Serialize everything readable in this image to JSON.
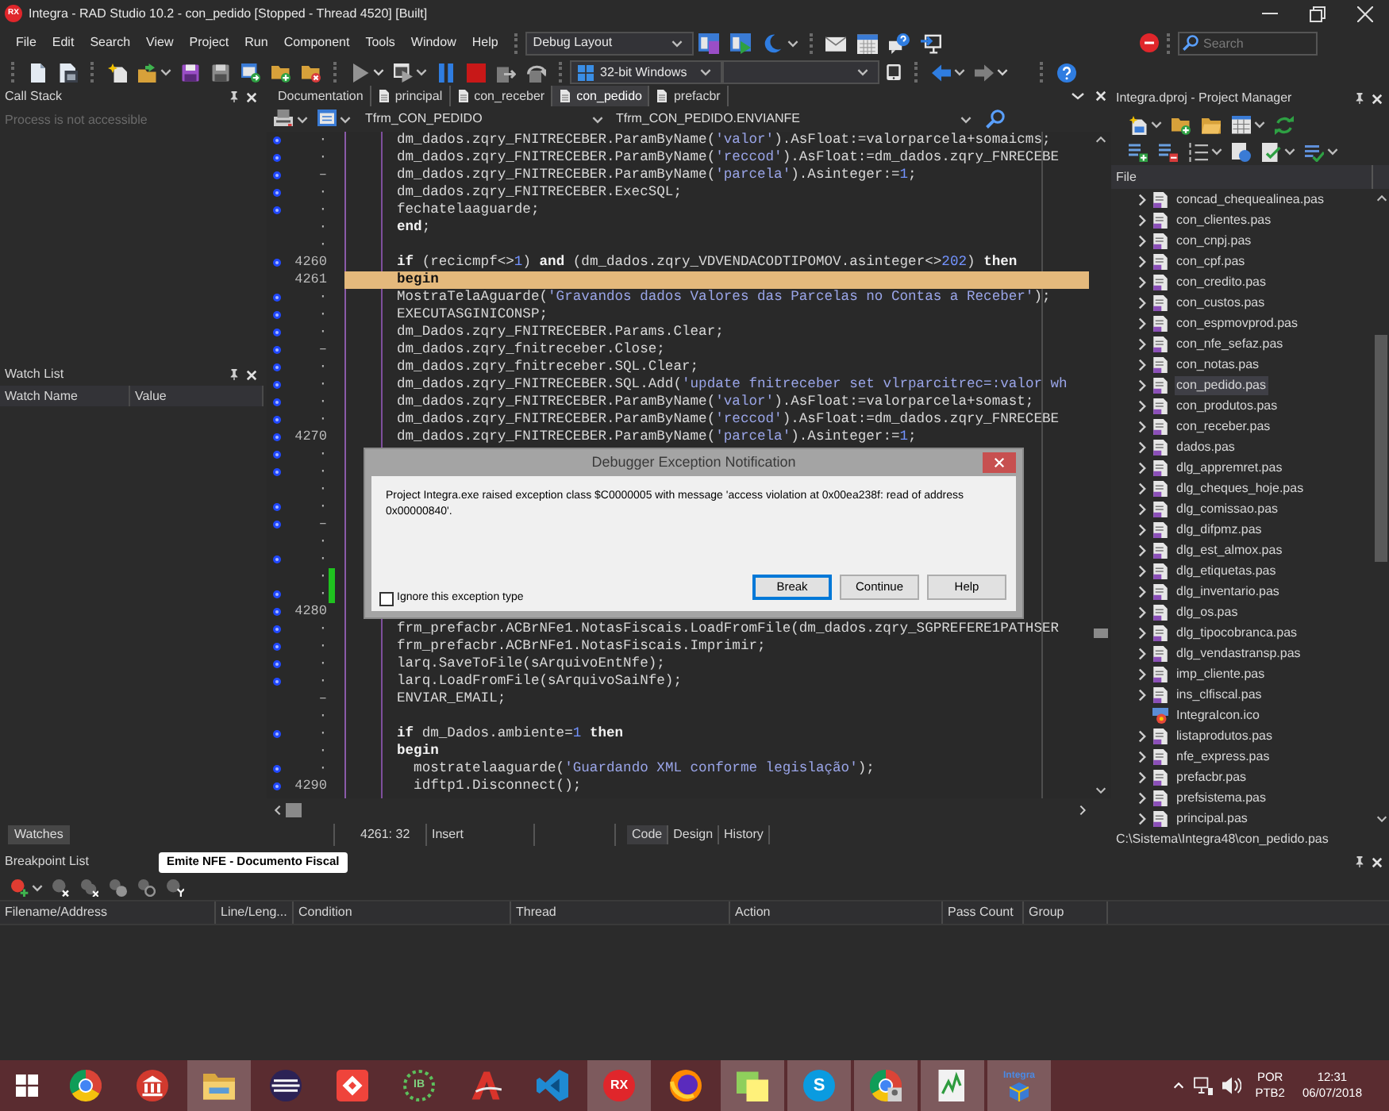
{
  "window": {
    "logo": "RX",
    "title": "Integra - RAD Studio 10.2 - con_pedido [Stopped - Thread 4520] [Built]"
  },
  "menu": [
    "File",
    "Edit",
    "Search",
    "View",
    "Project",
    "Run",
    "Component",
    "Tools",
    "Window",
    "Help"
  ],
  "layout_selector": {
    "value": "Debug Layout"
  },
  "search": {
    "placeholder": "Search"
  },
  "toolbar": [
    [
      {
        "kind": "new-file",
        "disabled": false,
        "dropdown": false
      },
      {
        "kind": "form",
        "disabled": false,
        "dropdown": false
      }
    ],
    [
      {
        "kind": "new-item",
        "disabled": false,
        "dropdown": false
      },
      {
        "kind": "open",
        "disabled": false,
        "dropdown": true
      },
      {
        "kind": "save",
        "disabled": false,
        "dropdown": false
      },
      {
        "kind": "save-all",
        "disabled": false,
        "dropdown": false
      },
      {
        "kind": "open-project",
        "disabled": false,
        "dropdown": false
      },
      {
        "kind": "add-folder",
        "disabled": false,
        "dropdown": false
      },
      {
        "kind": "remove-folder",
        "disabled": false,
        "dropdown": false
      }
    ],
    [
      {
        "kind": "run",
        "disabled": true,
        "dropdown": true
      },
      {
        "kind": "run-no-debug",
        "disabled": false,
        "dropdown": true
      },
      {
        "kind": "pause",
        "disabled": false,
        "dropdown": false
      },
      {
        "kind": "stop",
        "disabled": false,
        "dropdown": false
      },
      {
        "kind": "step-into",
        "disabled": true,
        "dropdown": false
      },
      {
        "kind": "step-over",
        "disabled": true,
        "dropdown": false
      }
    ]
  ],
  "platform": {
    "value": "32-bit Windows"
  },
  "navigation": [
    {
      "kind": "back",
      "disabled": false,
      "dropdown": true
    },
    {
      "kind": "forward",
      "disabled": true,
      "dropdown": true
    }
  ],
  "call_stack": {
    "title": "Call Stack",
    "message": "Process is not accessible"
  },
  "watch_list": {
    "title": "Watch List",
    "columns": [
      "Watch Name",
      "Value"
    ]
  },
  "left_tabs": [
    {
      "label": "Watches",
      "selected": true
    }
  ],
  "editor": {
    "tabs": [
      {
        "label": "Documentation",
        "kind": "view",
        "selected": false
      },
      {
        "label": "principal",
        "kind": "file",
        "selected": false
      },
      {
        "label": "con_receber",
        "kind": "file",
        "selected": false
      },
      {
        "label": "con_pedido",
        "kind": "file",
        "selected": true
      },
      {
        "label": "prefacbr",
        "kind": "file",
        "selected": false
      }
    ],
    "class_selector": "Tfrm_CON_PEDIDO",
    "method_selector": "Tfrm_CON_PEDIDO.ENVIANFE",
    "lines": [
      {
        "number": "·",
        "executable": true,
        "modified": false,
        "current": false,
        "kind": "code",
        "text": "dm_dados.zqry_FNITRECEBER.ParamByName('valor').AsFloat:=valorparcela+somaicms;"
      },
      {
        "number": "·",
        "executable": true,
        "modified": false,
        "current": false,
        "kind": "code",
        "text": "dm_dados.zqry_FNITRECEBER.ParamByName('reccod').AsFloat:=dm_dados.zqry_FNRECEBE"
      },
      {
        "number": "–",
        "executable": true,
        "modified": false,
        "current": false,
        "kind": "code",
        "text": "dm_dados.zqry_FNITRECEBER.ParamByName('parcela').Asinteger:=1;"
      },
      {
        "number": "·",
        "executable": true,
        "modified": false,
        "current": false,
        "kind": "code",
        "text": "dm_dados.zqry_FNITRECEBER.ExecSQL;"
      },
      {
        "number": "·",
        "executable": true,
        "modified": false,
        "current": false,
        "kind": "code",
        "text": "fechatelaaguarde;"
      },
      {
        "number": "·",
        "executable": false,
        "modified": false,
        "current": false,
        "kind": "code",
        "text": "**end**;"
      },
      {
        "number": "·",
        "executable": false,
        "modified": false,
        "current": false
      },
      {
        "number": "4260",
        "executable": true,
        "modified": false,
        "current": false,
        "kind": "code",
        "text": "**if** (recicmpf<>1) **and** (dm_dados.zqry_VDVENDACODTIPOMOV.asinteger<>202) **then**"
      },
      {
        "number": "4261",
        "executable": false,
        "modified": false,
        "current": true,
        "kind": "keyword",
        "text": "begin"
      },
      {
        "number": "·",
        "executable": true,
        "modified": false,
        "current": false,
        "kind": "code",
        "text": "MostraTelaAguarde('Gravandos dados Valores das Parcelas no Contas a Receber');"
      },
      {
        "number": "·",
        "executable": true,
        "modified": false,
        "current": false,
        "kind": "code",
        "text": "EXECUTASGINICONSP;"
      },
      {
        "number": "·",
        "executable": true,
        "modified": false,
        "current": false,
        "kind": "code",
        "text": "dm_Dados.zqry_FNITRECEBER.Params.Clear;"
      },
      {
        "number": "–",
        "executable": true,
        "modified": false,
        "current": false,
        "kind": "code",
        "text": "dm_dados.zqry_fnitreceber.Close;"
      },
      {
        "number": "·",
        "executable": true,
        "modified": false,
        "current": false,
        "kind": "code",
        "text": "dm_dados.zqry_fnitreceber.SQL.Clear;"
      },
      {
        "number": "·",
        "executable": true,
        "modified": false,
        "current": false,
        "kind": "code",
        "text": "dm_dados.zqry_FNITRECEBER.SQL.Add('update fnitreceber set vlrparcitrec=:valor wh"
      },
      {
        "number": "·",
        "executable": true,
        "modified": false,
        "current": false,
        "kind": "code",
        "text": "dm_dados.zqry_FNITRECEBER.ParamByName('valor').AsFloat:=valorparcela+somast;"
      },
      {
        "number": "·",
        "executable": true,
        "modified": false,
        "current": false,
        "kind": "code",
        "text": "dm_dados.zqry_FNITRECEBER.ParamByName('reccod').AsFloat:=dm_dados.zqry_FNRECEBE"
      },
      {
        "number": "4270",
        "executable": true,
        "modified": false,
        "current": false,
        "kind": "code",
        "text": "dm_dados.zqry_FNITRECEBER.ParamByName('parcela').Asinteger:=1;"
      },
      {
        "number": "·",
        "executable": true,
        "modified": false,
        "current": false
      },
      {
        "number": "·",
        "executable": true,
        "modified": false,
        "current": false
      },
      {
        "number": "·",
        "executable": false,
        "modified": false,
        "current": false
      },
      {
        "number": "·",
        "executable": true,
        "modified": false,
        "current": false
      },
      {
        "number": "–",
        "executable": true,
        "modified": false,
        "current": false
      },
      {
        "number": "·",
        "executable": false,
        "modified": false,
        "current": false
      },
      {
        "number": "·",
        "executable": true,
        "modified": false,
        "current": false
      },
      {
        "number": "·",
        "executable": false,
        "modified": true,
        "current": false
      },
      {
        "number": "·",
        "executable": true,
        "modified": true,
        "current": false
      },
      {
        "number": "4280",
        "executable": true,
        "modified": false,
        "current": false
      },
      {
        "number": "·",
        "executable": true,
        "modified": false,
        "current": false,
        "kind": "code",
        "text": "frm_prefacbr.ACBrNFe1.NotasFiscais.LoadFromFile(dm_dados.zqry_SGPREFERE1PATHSER"
      },
      {
        "number": "·",
        "executable": true,
        "modified": false,
        "current": false,
        "kind": "code",
        "text": "frm_prefacbr.ACBrNFe1.NotasFiscais.Imprimir;"
      },
      {
        "number": "·",
        "executable": true,
        "modified": false,
        "current": false,
        "kind": "code",
        "text": "larq.SaveToFile(sArquivoEntNfe);"
      },
      {
        "number": "·",
        "executable": true,
        "modified": false,
        "current": false,
        "kind": "code",
        "text": "larq.LoadFromFile(sArquivoSaiNfe);"
      },
      {
        "number": "–",
        "executable": false,
        "modified": false,
        "current": false,
        "kind": "code",
        "text": "ENVIAR_EMAIL;"
      },
      {
        "number": "·",
        "executable": false,
        "modified": false,
        "current": false
      },
      {
        "number": "·",
        "executable": true,
        "modified": false,
        "current": false,
        "kind": "code",
        "text": "**if** dm_Dados.ambiente=1 **then**"
      },
      {
        "number": "·",
        "executable": false,
        "modified": false,
        "current": false,
        "kind": "keyword",
        "text": "begin"
      },
      {
        "number": "·",
        "executable": true,
        "modified": false,
        "current": false,
        "kind": "code",
        "text": "  mostratelaaguarde('Guardando XML conforme legislação');"
      },
      {
        "number": "4290",
        "executable": true,
        "modified": false,
        "current": false,
        "kind": "code",
        "text": "  idftp1.Disconnect();"
      }
    ],
    "status": {
      "position": "4261: 32",
      "mode": "Insert"
    },
    "views": [
      {
        "label": "Code",
        "selected": true
      },
      {
        "label": "Design",
        "selected": false
      },
      {
        "label": "History",
        "selected": false
      }
    ]
  },
  "exception_dialog": {
    "title": "Debugger Exception Notification",
    "message": "Project Integra.exe raised exception class $C0000005 with message 'access violation at 0x00ea238f: read of address 0x00000840'.",
    "checkbox": {
      "label": "Ignore this exception type",
      "checked": false
    },
    "buttons": [
      {
        "label": "Break",
        "default": true
      },
      {
        "label": "Continue",
        "default": false
      },
      {
        "label": "Help",
        "default": false
      }
    ]
  },
  "project_manager": {
    "title": "Integra.dproj - Project Manager",
    "column": "File",
    "items": [
      {
        "label": "concad_chequealinea.pas",
        "kind": "unit",
        "expanded": false,
        "selected": false
      },
      {
        "label": "con_clientes.pas",
        "kind": "unit",
        "expanded": false,
        "selected": false
      },
      {
        "label": "con_cnpj.pas",
        "kind": "unit",
        "expanded": false,
        "selected": false
      },
      {
        "label": "con_cpf.pas",
        "kind": "unit",
        "expanded": false,
        "selected": false
      },
      {
        "label": "con_credito.pas",
        "kind": "unit",
        "expanded": false,
        "selected": false
      },
      {
        "label": "con_custos.pas",
        "kind": "unit",
        "expanded": false,
        "selected": false
      },
      {
        "label": "con_espmovprod.pas",
        "kind": "unit",
        "expanded": false,
        "selected": false
      },
      {
        "label": "con_nfe_sefaz.pas",
        "kind": "unit",
        "expanded": false,
        "selected": false
      },
      {
        "label": "con_notas.pas",
        "kind": "unit",
        "expanded": false,
        "selected": false
      },
      {
        "label": "con_pedido.pas",
        "kind": "unit",
        "expanded": false,
        "selected": true
      },
      {
        "label": "con_produtos.pas",
        "kind": "unit",
        "expanded": false,
        "selected": false
      },
      {
        "label": "con_receber.pas",
        "kind": "unit",
        "expanded": false,
        "selected": false
      },
      {
        "label": "dados.pas",
        "kind": "unit",
        "expanded": false,
        "selected": false
      },
      {
        "label": "dlg_appremret.pas",
        "kind": "unit",
        "expanded": false,
        "selected": false
      },
      {
        "label": "dlg_cheques_hoje.pas",
        "kind": "unit",
        "expanded": false,
        "selected": false
      },
      {
        "label": "dlg_comissao.pas",
        "kind": "unit",
        "expanded": false,
        "selected": false
      },
      {
        "label": "dlg_difpmz.pas",
        "kind": "unit",
        "expanded": false,
        "selected": false
      },
      {
        "label": "dlg_est_almox.pas",
        "kind": "unit",
        "expanded": false,
        "selected": false
      },
      {
        "label": "dlg_etiquetas.pas",
        "kind": "unit",
        "expanded": false,
        "selected": false
      },
      {
        "label": "dlg_inventario.pas",
        "kind": "unit",
        "expanded": false,
        "selected": false
      },
      {
        "label": "dlg_os.pas",
        "kind": "unit",
        "expanded": false,
        "selected": false
      },
      {
        "label": "dlg_tipocobranca.pas",
        "kind": "unit",
        "expanded": false,
        "selected": false
      },
      {
        "label": "dlg_vendastransp.pas",
        "kind": "unit",
        "expanded": false,
        "selected": false
      },
      {
        "label": "imp_cliente.pas",
        "kind": "unit",
        "expanded": false,
        "selected": false
      },
      {
        "label": "ins_clfiscal.pas",
        "kind": "unit",
        "expanded": false,
        "selected": false
      },
      {
        "label": "IntegraIcon.ico",
        "kind": "image",
        "selected": false
      },
      {
        "label": "listaprodutos.pas",
        "kind": "unit",
        "expanded": false,
        "selected": false
      },
      {
        "label": "nfe_express.pas",
        "kind": "unit",
        "expanded": false,
        "selected": false
      },
      {
        "label": "prefacbr.pas",
        "kind": "unit",
        "expanded": false,
        "selected": false
      },
      {
        "label": "prefsistema.pas",
        "kind": "unit",
        "expanded": false,
        "selected": false
      },
      {
        "label": "principal.pas",
        "kind": "unit",
        "expanded": false,
        "selected": false
      }
    ],
    "path": "C:\\Sistema\\Integra48\\con_pedido.pas"
  },
  "breakpoint_list": {
    "title": "Breakpoint List",
    "toolbar": [
      {
        "kind": "add",
        "disabled": false,
        "dropdown": true
      },
      {
        "kind": "delete",
        "disabled": true,
        "dropdown": false
      },
      {
        "kind": "delete-all",
        "disabled": true,
        "dropdown": false
      },
      {
        "kind": "enable-all",
        "disabled": true,
        "dropdown": false
      },
      {
        "kind": "disable-all",
        "disabled": true,
        "dropdown": false
      },
      {
        "kind": "group",
        "disabled": true,
        "dropdown": false
      }
    ],
    "columns": [
      "Filename/Address",
      "Line/Leng...",
      "Condition",
      "Thread",
      "Action",
      "Pass Count",
      "Group"
    ]
  },
  "tooltip": {
    "text": "Emite NFE - Documento Fiscal"
  },
  "taskbar": {
    "apps": [
      {
        "kind": "ring",
        "open": false
      },
      {
        "kind": "columns",
        "open": false
      },
      {
        "kind": "folder",
        "open": true
      },
      {
        "kind": "striped-circle",
        "open": false
      },
      {
        "kind": "diamond",
        "open": false
      },
      {
        "kind": "dot-ring",
        "open": false,
        "text": "IB"
      },
      {
        "kind": "wedge",
        "open": false
      },
      {
        "kind": "ribbon",
        "open": false
      },
      {
        "kind": "text-badge",
        "open": true,
        "text": "RX"
      },
      {
        "kind": "globe",
        "open": false
      },
      {
        "kind": "notes",
        "open": true
      },
      {
        "kind": "letter-circle",
        "open": true,
        "text": "S"
      },
      {
        "kind": "ring-user",
        "open": true
      },
      {
        "kind": "pad",
        "open": true
      },
      {
        "kind": "thumbnail",
        "open": true,
        "text": "Integra"
      }
    ],
    "language": "POR",
    "keyboard": "PTB2",
    "time": "12:31",
    "date": "06/07/2018"
  }
}
